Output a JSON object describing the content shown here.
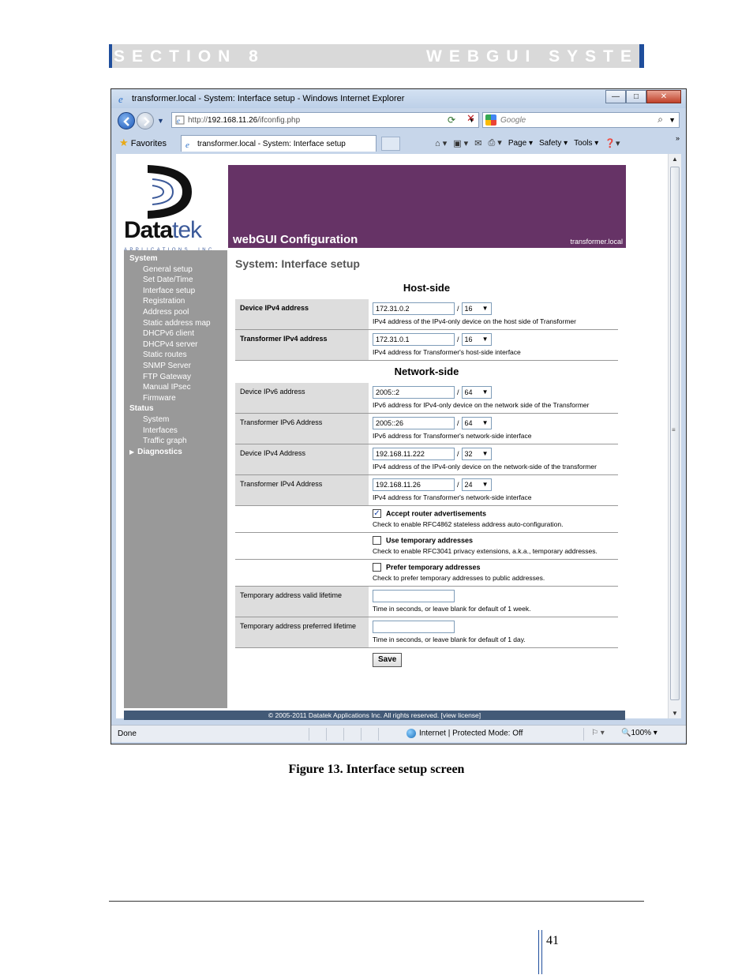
{
  "doc": {
    "section_left": "SECTION 8",
    "section_right": "WEBGUI SYSTEM",
    "caption": "Figure 13. Interface setup screen",
    "page_number": "41"
  },
  "browser": {
    "window_title": "transformer.local - System: Interface setup - Windows Internet Explorer",
    "url_prefix": "http://",
    "url_host": "192.168.11.26",
    "url_path": "/ifconfig.php",
    "search_placeholder": "Google",
    "favorites_label": "Favorites",
    "tab_title": "transformer.local - System: Interface setup",
    "commands": {
      "page": "Page",
      "safety": "Safety",
      "tools": "Tools"
    },
    "status": {
      "left": "Done",
      "zone": "Internet | Protected Mode: Off",
      "zoom": "100%"
    }
  },
  "site": {
    "logo_main": "Data",
    "logo_tek": "tek",
    "logo_sub": "APPLICATIONS, INC",
    "banner_title": "webGUI Configuration",
    "banner_host": "transformer.local",
    "page_title": "System: Interface setup",
    "footer": "© 2005-2011 Datatek Applications Inc. All rights reserved.  [view license]"
  },
  "sidebar": {
    "system_label": "System",
    "system_items": [
      "General setup",
      "Set Date/Time",
      "Interface setup",
      "Registration",
      "Address pool",
      "Static address map",
      "DHCPv6 client",
      "DHCPv4 server",
      "Static routes",
      "SNMP Server",
      "FTP Gateway",
      "Manual IPsec",
      "Firmware"
    ],
    "status_label": "Status",
    "status_items": [
      "System",
      "Interfaces",
      "Traffic graph"
    ],
    "diagnostics_label": "Diagnostics"
  },
  "form": {
    "host_heading": "Host-side",
    "network_heading": "Network-side",
    "host_rows": [
      {
        "label": "Device IPv4 address",
        "value": "172.31.0.2",
        "prefix": "16",
        "hint": "IPv4 address of the IPv4-only device on the host side of Transformer"
      },
      {
        "label": "Transformer IPv4 address",
        "value": "172.31.0.1",
        "prefix": "16",
        "hint": "IPv4 address for Transformer's host-side interface"
      }
    ],
    "network_rows": [
      {
        "label": "Device IPv6 address",
        "value": "2005::2",
        "prefix": "64",
        "hint": "IPv6 address for IPv4-only device on the network side of the Transformer"
      },
      {
        "label": "Transformer IPv6 Address",
        "value": "2005::26",
        "prefix": "64",
        "hint": "IPv6 address for Transformer's network-side interface"
      },
      {
        "label": "Device IPv4 Address",
        "value": "192.168.11.222",
        "prefix": "32",
        "hint": "IPv4 address of the IPv4-only device on the network-side of the transformer"
      },
      {
        "label": "Transformer IPv4 Address",
        "value": "192.168.11.26",
        "prefix": "24",
        "hint": "IPv4 address for Transformer's network-side interface"
      }
    ],
    "checks": [
      {
        "label": "Accept router advertisements",
        "checked": true,
        "hint": "Check to enable RFC4862 stateless address auto-configuration."
      },
      {
        "label": "Use temporary addresses",
        "checked": false,
        "hint": "Check to enable RFC3041 privacy extensions, a.k.a., temporary addresses."
      },
      {
        "label": "Prefer temporary addresses",
        "checked": false,
        "hint": "Check to prefer temporary addresses to public addresses."
      }
    ],
    "lifetimes": [
      {
        "label": "Temporary address valid lifetime",
        "value": "",
        "hint": "Time in seconds, or leave blank for default of 1 week."
      },
      {
        "label": "Temporary address preferred lifetime",
        "value": "",
        "hint": "Time in seconds, or leave blank for default of 1 day."
      }
    ],
    "save_label": "Save"
  },
  "colors": {
    "banner": "#663366",
    "sidebar": "#999999",
    "footer": "#435a77",
    "accent_blue": "#1f4e9c"
  }
}
